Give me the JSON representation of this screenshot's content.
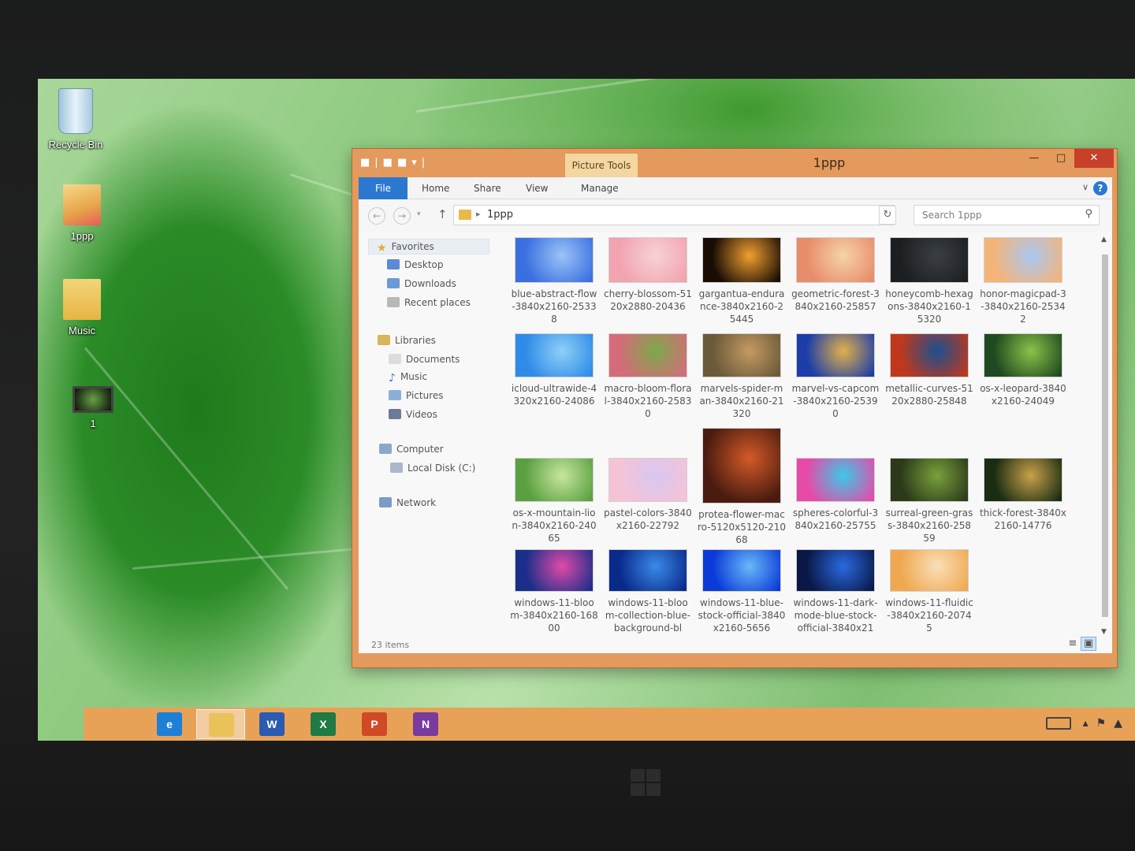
{
  "desktop": {
    "icons": [
      {
        "label": "Recycle Bin",
        "icon": "recycle-bin-icon"
      },
      {
        "label": "1ppp",
        "icon": "folder-icon"
      },
      {
        "label": "Music",
        "icon": "folder-icon"
      },
      {
        "label": "1",
        "icon": "video-file-icon"
      }
    ]
  },
  "window": {
    "title": "1ppp",
    "context_tab": "Picture Tools",
    "ribbon_tabs": {
      "file": "File",
      "home": "Home",
      "share": "Share",
      "view": "View",
      "manage": "Manage"
    },
    "help": "?",
    "address": {
      "path": "1ppp"
    },
    "search": {
      "placeholder": "Search 1ppp"
    },
    "nav": {
      "favorites": "Favorites",
      "desktop": "Desktop",
      "downloads": "Downloads",
      "recent": "Recent places",
      "libraries": "Libraries",
      "documents": "Documents",
      "music": "Music",
      "pictures": "Pictures",
      "videos": "Videos",
      "computer": "Computer",
      "localdisk": "Local Disk (C:)",
      "network": "Network"
    },
    "files": [
      {
        "name": "blue-abstract-flow-3840x2160-25338",
        "colors": [
          "#3a6fe0",
          "#9bc4f7"
        ]
      },
      {
        "name": "cherry-blossom-5120x2880-20436",
        "colors": [
          "#f2a3b0",
          "#f7d2d6"
        ]
      },
      {
        "name": "gargantua-endurance-3840x2160-25445",
        "colors": [
          "#1a0d05",
          "#f0a030"
        ]
      },
      {
        "name": "geometric-forest-3840x2160-25857",
        "colors": [
          "#e88c6a",
          "#f5d3a8"
        ]
      },
      {
        "name": "honeycomb-hexagons-3840x2160-15320",
        "colors": [
          "#1c1f22",
          "#3a3f44"
        ]
      },
      {
        "name": "honor-magicpad-3-3840x2160-25342",
        "colors": [
          "#f3b47a",
          "#a9c8f3"
        ]
      },
      {
        "name": "icloud-ultrawide-4320x2160-24086",
        "colors": [
          "#2e8be8",
          "#8fd0f7"
        ]
      },
      {
        "name": "macro-bloom-floral-3840x2160-25830",
        "colors": [
          "#d46c7a",
          "#7da84a"
        ]
      },
      {
        "name": "marvels-spider-man-3840x2160-21320",
        "colors": [
          "#6b5a3a",
          "#c49a62"
        ]
      },
      {
        "name": "marvel-vs-capcom-3840x2160-25390",
        "colors": [
          "#1d3ea8",
          "#e2b04a"
        ]
      },
      {
        "name": "metallic-curves-5120x2880-25848",
        "colors": [
          "#c0381c",
          "#1c4f90"
        ]
      },
      {
        "name": "os-x-leopard-3840x2160-24049",
        "colors": [
          "#1f4a1f",
          "#8bc34a"
        ]
      },
      {
        "name": "os-x-mountain-lion-3840x2160-24065",
        "colors": [
          "#5aa040",
          "#c8e6a0"
        ]
      },
      {
        "name": "pastel-colors-3840x2160-22792",
        "colors": [
          "#f5c3d6",
          "#d8c6f2"
        ]
      },
      {
        "name": "protea-flower-macro-5120x5120-21068",
        "colors": [
          "#4a1c10",
          "#d45a28"
        ]
      },
      {
        "name": "spheres-colorful-3840x2160-25755",
        "colors": [
          "#e84aa8",
          "#3ac8e8"
        ]
      },
      {
        "name": "surreal-green-grass-3840x2160-25859",
        "colors": [
          "#2c3a1a",
          "#79a03a"
        ]
      },
      {
        "name": "thick-forest-3840x2160-14776",
        "colors": [
          "#1a2c12",
          "#c8a24a"
        ]
      },
      {
        "name": "windows-11-bloom-3840x2160-16800",
        "colors": [
          "#1a2e8a",
          "#e04aa8"
        ]
      },
      {
        "name": "windows-11-bloom-collection-blue-background-bl",
        "colors": [
          "#0a2a8a",
          "#3a8ae8"
        ]
      },
      {
        "name": "windows-11-blue-stock-official-3840x2160-5656",
        "colors": [
          "#0a3ad8",
          "#6ab8f8"
        ]
      },
      {
        "name": "windows-11-dark-mode-blue-stock-official-3840x21",
        "colors": [
          "#0a1848",
          "#2a6ae0"
        ]
      },
      {
        "name": "windows-11-fluidic-3840x2160-20745",
        "colors": [
          "#f0a850",
          "#f8e0b8"
        ]
      }
    ],
    "status": "23 items"
  },
  "taskbar": {
    "apps": [
      {
        "label": "e",
        "icon": "internet-explorer-icon",
        "color": "#1e7fd8"
      },
      {
        "label": "",
        "icon": "file-explorer-icon",
        "color": "#e9c35a"
      },
      {
        "label": "W",
        "icon": "word-icon",
        "color": "#2b5bb0"
      },
      {
        "label": "X",
        "icon": "excel-icon",
        "color": "#1f7a44"
      },
      {
        "label": "P",
        "icon": "powerpoint-icon",
        "color": "#d04a26"
      },
      {
        "label": "N",
        "icon": "onenote-icon",
        "color": "#7a3a9e"
      }
    ]
  }
}
